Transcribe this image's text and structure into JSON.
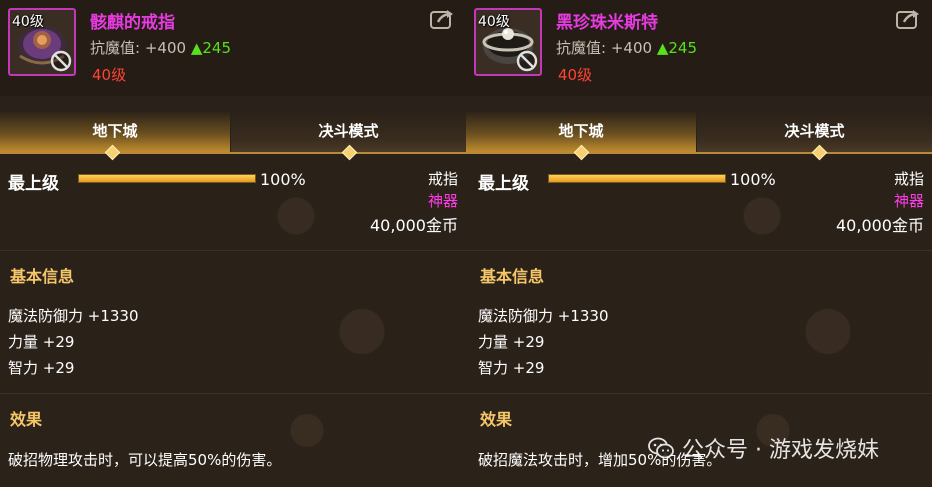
{
  "panels": [
    {
      "level_tag": "40级",
      "name": "骸麒的戒指",
      "resist_label": "抗魔值:",
      "resist_base": "+400",
      "resist_up": "▲245",
      "req_level": "40级",
      "tabs": [
        "地下城",
        "决斗模式"
      ],
      "rank_label": "最上级",
      "rank_percent": "100%",
      "rank_fill": 1.0,
      "item_type": "戒指",
      "item_grade": "神器",
      "price": "40,000金币",
      "basic_title": "基本信息",
      "stats": [
        "魔法防御力 +1330",
        "力量 +29",
        "智力 +29"
      ],
      "effect_title": "效果",
      "effect_text": "破招物理攻击时，可以提高50%的伤害。"
    },
    {
      "level_tag": "40级",
      "name": "黑珍珠米斯特",
      "resist_label": "抗魔值:",
      "resist_base": "+400",
      "resist_up": "▲245",
      "req_level": "40级",
      "tabs": [
        "地下城",
        "决斗模式"
      ],
      "rank_label": "最上级",
      "rank_percent": "100%",
      "rank_fill": 1.0,
      "item_type": "戒指",
      "item_grade": "神器",
      "price": "40,000金币",
      "basic_title": "基本信息",
      "stats": [
        "魔法防御力 +1330",
        "力量 +29",
        "智力 +29"
      ],
      "effect_title": "效果",
      "effect_text": "破招魔法攻击时，增加50%的伤害。"
    }
  ],
  "watermark": {
    "text": "公众号 · 游戏发烧妹",
    "icon": "wechat-icon"
  },
  "colors": {
    "item_name": "#e63be0",
    "resist_up": "#58e01d",
    "req_level": "#ff4433",
    "grade": "#ff3ce8",
    "section_title": "#f6c66a",
    "icon_border": "#c338b8"
  }
}
